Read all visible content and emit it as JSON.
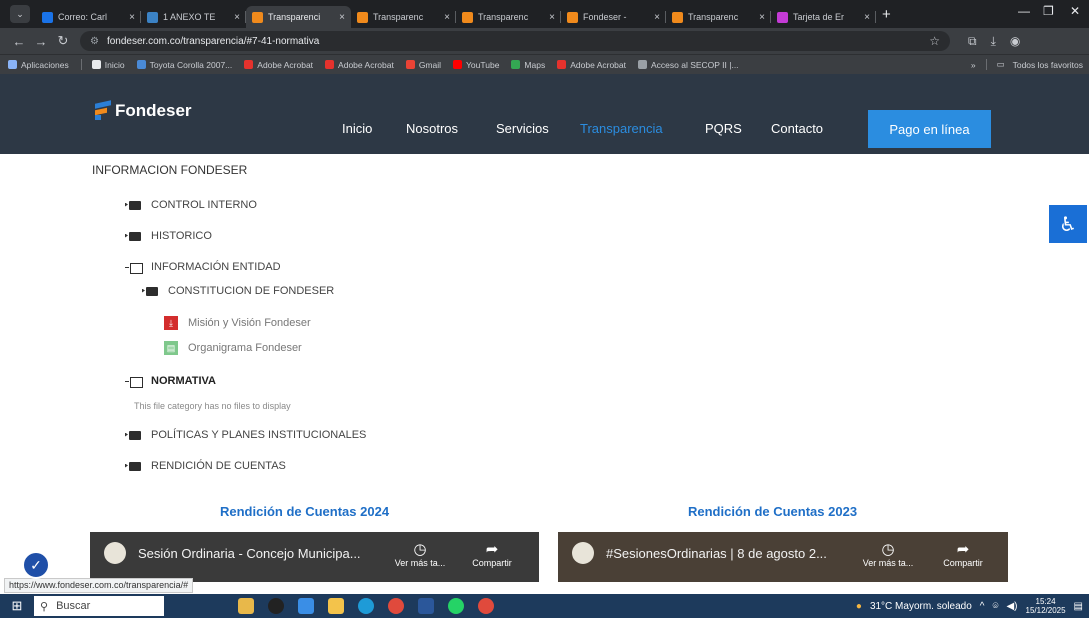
{
  "browser": {
    "tabs": [
      {
        "label": "Correo: Carl",
        "color": "#1a73e8",
        "active": false
      },
      {
        "label": "1 ANEXO TE",
        "color": "#3b82c4",
        "active": false
      },
      {
        "label": "Transparenci",
        "color": "#f08a1c",
        "active": true
      },
      {
        "label": "Transparenc",
        "color": "#f08a1c",
        "active": false
      },
      {
        "label": "Transparenc",
        "color": "#f08a1c",
        "active": false
      },
      {
        "label": "Fondeser -",
        "color": "#f08a1c",
        "active": false
      },
      {
        "label": "Transparenc",
        "color": "#f08a1c",
        "active": false
      },
      {
        "label": "Tarjeta de Er",
        "color": "#c43bd6",
        "active": false
      }
    ],
    "url": "fondeser.com.co/transparencia/#7-41-normativa",
    "bookmarks": [
      {
        "label": "Aplicaciones",
        "color": "#8ab4f8"
      },
      {
        "label": "Inicio",
        "color": "#e8eaed"
      },
      {
        "label": "Toyota Corolla 2007...",
        "color": "#4a8ad6"
      },
      {
        "label": "Adobe Acrobat",
        "color": "#e5322d"
      },
      {
        "label": "Adobe Acrobat",
        "color": "#e5322d"
      },
      {
        "label": "Gmail",
        "color": "#ea4335"
      },
      {
        "label": "YouTube",
        "color": "#ff0000"
      },
      {
        "label": "Maps",
        "color": "#34a853"
      },
      {
        "label": "Adobe Acrobat",
        "color": "#e5322d"
      },
      {
        "label": "Acceso al SECOP II |...",
        "color": "#9aa0a6"
      }
    ],
    "bookmarks_more": "»",
    "all_bookmarks": "Todos los favoritos"
  },
  "site": {
    "logo": "Fondeser",
    "nav": [
      "Inicio",
      "Nosotros",
      "Servicios",
      "Transparencia",
      "PQRS",
      "Contacto"
    ],
    "pay_button": "Pago en línea",
    "accent": "#2b8de0"
  },
  "content": {
    "section_title": "INFORMACION FONDESER",
    "tree": {
      "control_interno": "CONTROL INTERNO",
      "historico": "HISTORICO",
      "informacion_entidad": "INFORMACIÓN ENTIDAD",
      "constitucion": "CONSTITUCION DE FONDESER",
      "mision": "Misión y Visión Fondeser",
      "organigrama": "Organigrama Fondeser",
      "normativa": "NORMATIVA",
      "no_files": "This file category has no files to display",
      "politicas": "POLÍTICAS Y PLANES INSTITUCIONALES",
      "rendicion": "RENDICIÓN DE CUENTAS"
    },
    "rc_2024": "Rendición de Cuentas 2024",
    "rc_2023": "Rendición de Cuentas 2023",
    "video_2024_title": "Sesión Ordinaria - Concejo Municipa...",
    "video_2023_title": "#SesionesOrdinarias | 8 de agosto 2...",
    "ver_mas": "Ver más ta...",
    "compartir": "Compartir"
  },
  "status_url": "https://www.fondeser.com.co/transparencia/#",
  "taskbar": {
    "search": "Buscar",
    "weather": "31°C  Mayorm. soleado",
    "time": "15:24",
    "date": "15/12/2025"
  }
}
